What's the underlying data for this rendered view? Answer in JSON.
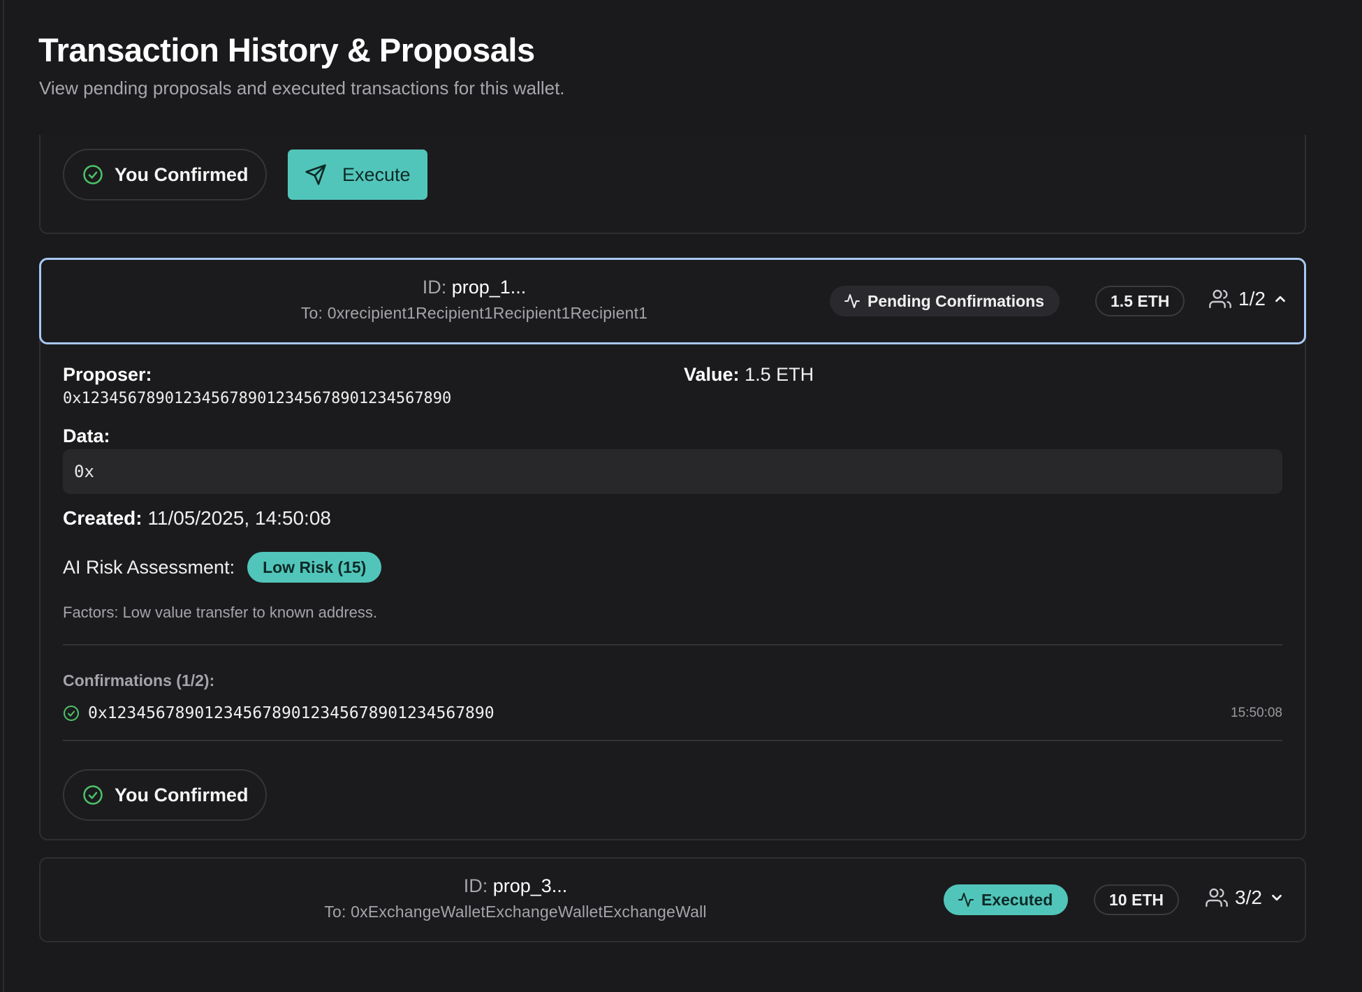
{
  "header": {
    "title": "Transaction History & Proposals",
    "subtitle": "View pending proposals and executed transactions for this wallet."
  },
  "card_top": {
    "confirmed_label": "You Confirmed",
    "execute_label": "Execute"
  },
  "proposal_1": {
    "id_key": "ID:",
    "id_value": "prop_1...",
    "to": "To: 0xrecipient1Recipient1Recipient1Recipient1",
    "status": "Pending Confirmations",
    "value_badge": "1.5 ETH",
    "confirmations": "1/2",
    "proposer_label": "Proposer:",
    "proposer_address": "0x1234567890123456789012345678901234567890",
    "value_label": "Value:",
    "value_text": "1.5 ETH",
    "data_label": "Data:",
    "data_value": "0x",
    "created_label": "Created:",
    "created_value": "11/05/2025, 14:50:08",
    "risk_label": "AI Risk Assessment:",
    "risk_badge": "Low Risk (15)",
    "risk_factors": "Factors: Low value transfer to known address.",
    "confirmations_heading": "Confirmations (1/2):",
    "confirmation_list": [
      {
        "address": "0x1234567890123456789012345678901234567890",
        "time": "15:50:08"
      }
    ],
    "confirmed_label": "You Confirmed"
  },
  "proposal_3": {
    "id_key": "ID:",
    "id_value": "prop_3...",
    "to": "To: 0xExchangeWalletExchangeWalletExchangeWall",
    "status": "Executed",
    "value_badge": "10 ETH",
    "confirmations": "3/2"
  },
  "colors": {
    "accent": "#52c5ba",
    "focus_ring": "#a9c8f2",
    "success": "#4cc46a",
    "background": "#1a1a1c"
  },
  "icons": {
    "confirmed": "check-circle-icon",
    "execute": "send-icon",
    "status": "activity-icon",
    "users": "users-icon",
    "expand": "chevron-up-icon",
    "collapse": "chevron-down-icon"
  }
}
